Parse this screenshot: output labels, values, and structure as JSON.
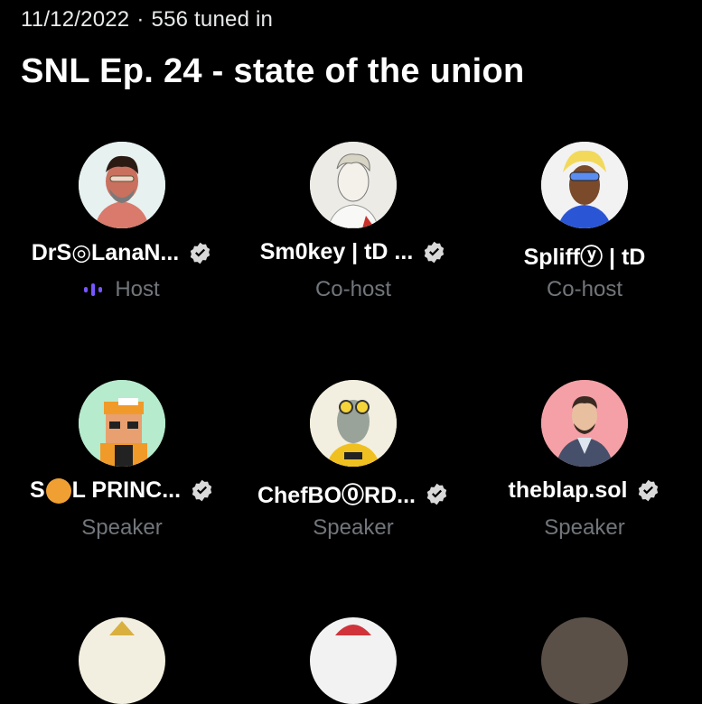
{
  "space": {
    "date": "11/12/2022",
    "separator": "·",
    "tuned_in": "556 tuned in",
    "title": "SNL Ep. 24 - state of the union"
  },
  "participants": [
    {
      "name": "DrS◎LanaN...",
      "role": "Host",
      "verified": true,
      "speaking": true,
      "avatar_bg": "#e6f1f0"
    },
    {
      "name": "Sm0key | tD ...",
      "role": "Co-host",
      "verified": true,
      "speaking": false,
      "avatar_bg": "#ecebe6"
    },
    {
      "name": "Spliffⓨ | tD",
      "role": "Co-host",
      "verified": false,
      "speaking": false,
      "avatar_bg": "#f2f2f2"
    },
    {
      "name_prefix": "S",
      "name_suffix": "L PRINC...",
      "role": "Speaker",
      "verified": true,
      "speaking": false,
      "avatar_bg": "#b6ebcd"
    },
    {
      "name": "ChefBO⓪RD...",
      "role": "Speaker",
      "verified": true,
      "speaking": false,
      "avatar_bg": "#f3efe0"
    },
    {
      "name": "theblap.sol",
      "role": "Speaker",
      "verified": true,
      "speaking": false,
      "avatar_bg": "#f4a0a6"
    }
  ],
  "colors": {
    "background": "#000000",
    "text": "#ffffff",
    "muted": "#71767b",
    "speaking_accent": "#7856ff",
    "verified_badge": "#d9d9d9"
  },
  "icons": {
    "verified": "verified-badge-icon",
    "speaking": "speaking-indicator-icon"
  }
}
